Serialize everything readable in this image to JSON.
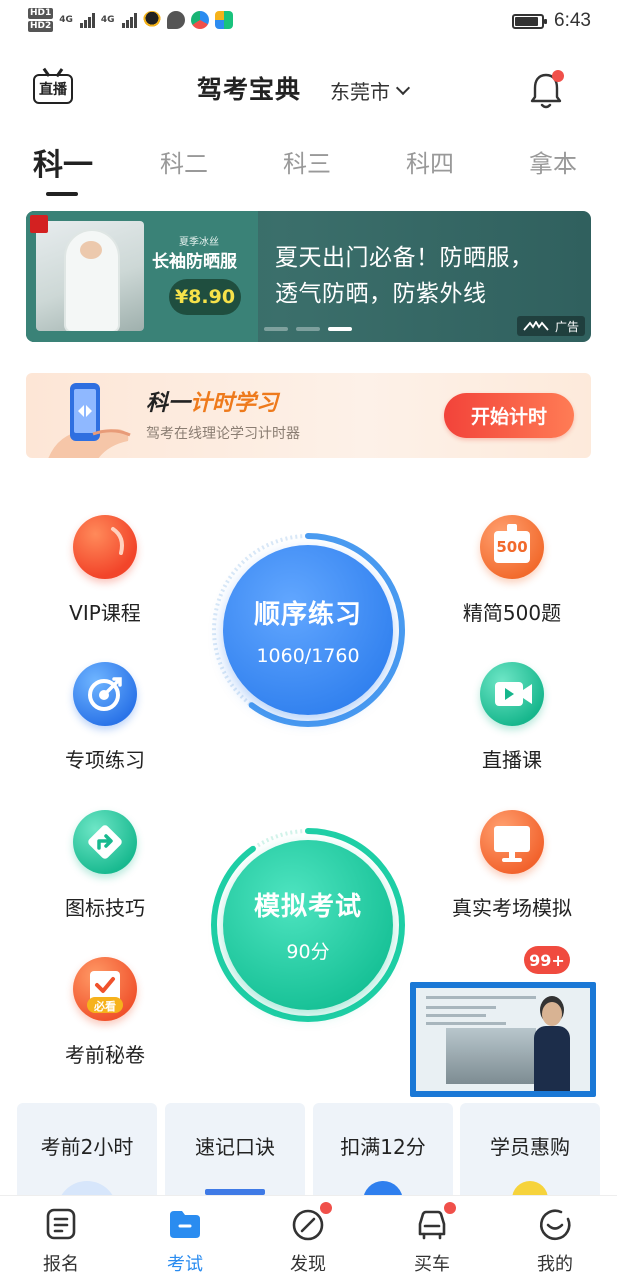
{
  "status_bar": {
    "time": "6:43",
    "net1": "4G",
    "net2": "4G",
    "hd1": "HD1",
    "hd2": "HD2"
  },
  "header": {
    "live_label": "直播",
    "title": "驾考宝典",
    "city": "东莞市"
  },
  "tabs": [
    {
      "label": "科一",
      "active": true
    },
    {
      "label": "科二"
    },
    {
      "label": "科三"
    },
    {
      "label": "科四"
    },
    {
      "label": "拿本"
    }
  ],
  "banner": {
    "promo_small": "夏季冰丝",
    "promo_big": "长袖防晒服",
    "price": "¥8.90",
    "headline_line1": "夏天出门必备！防晒服，",
    "headline_line2": "透气防晒，防紫外线",
    "ad_label": "广告",
    "active_dot": 3
  },
  "timer_card": {
    "title_a": "科一",
    "title_b": "计时学习",
    "subtitle": "驾考在线理论学习计时器",
    "button": "开始计时"
  },
  "features": {
    "vip": "VIP课程",
    "special": "专项练习",
    "signs": "图标技巧",
    "secret": "考前秘卷",
    "select500": "精简500题",
    "live": "直播课",
    "real_exam": "真实考场模拟",
    "icon_500_text": "500",
    "icon_secret_text": "必看"
  },
  "practice": {
    "title": "顺序练习",
    "progress": "1060/1760",
    "progress_fraction": 0.602
  },
  "mock": {
    "title": "模拟考试",
    "score": "90分",
    "progress_fraction": 0.9
  },
  "floating": {
    "badge": "99+"
  },
  "quick_cards": [
    {
      "label": "考前2小时"
    },
    {
      "label": "速记口诀"
    },
    {
      "label": "扣满12分"
    },
    {
      "label": "学员惠购"
    }
  ],
  "bottom_nav": [
    {
      "label": "报名",
      "icon": "form-icon"
    },
    {
      "label": "考试",
      "icon": "folder-icon",
      "active": true
    },
    {
      "label": "发现",
      "icon": "compass-icon",
      "dot": true
    },
    {
      "label": "买车",
      "icon": "car-icon",
      "dot": true
    },
    {
      "label": "我的",
      "icon": "smile-icon"
    }
  ],
  "colors": {
    "accent_blue": "#2a8cf0",
    "practice_blue": "#3a8ef3",
    "mock_green": "#1fcfa6",
    "alert_red": "#f0504a",
    "timer_orange": "#ee7a1c"
  }
}
